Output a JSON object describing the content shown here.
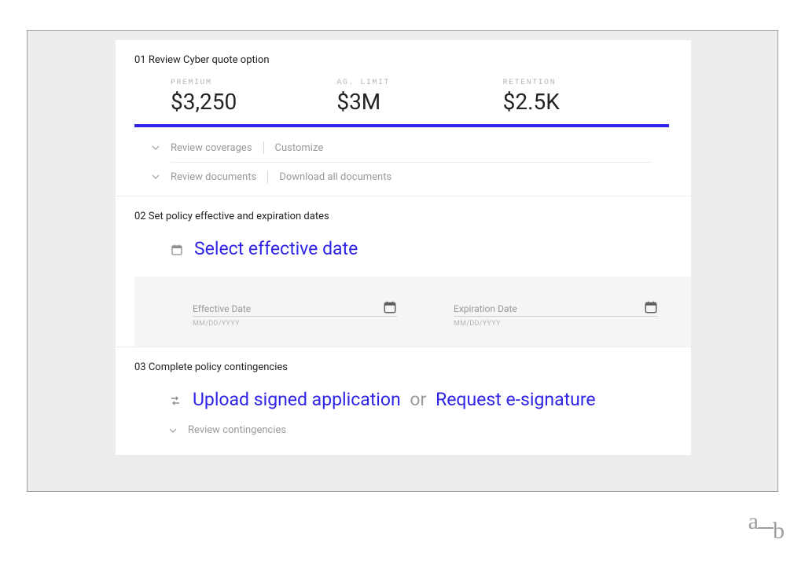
{
  "step1": {
    "title": "01 Review Cyber quote option",
    "metrics": {
      "premium_label": "PREMIUM",
      "premium_value": "$3,250",
      "limit_label": "AG. LIMIT",
      "limit_value": "$3M",
      "retention_label": "RETENTION",
      "retention_value": "$2.5K"
    },
    "review_coverages": "Review coverages",
    "customize": "Customize",
    "review_documents": "Review documents",
    "download_all": "Download all documents"
  },
  "step2": {
    "title": "02 Set policy effective and expiration dates",
    "headline": "Select effective date",
    "effective_label": "Effective Date",
    "expiration_label": "Expiration Date",
    "placeholder": "MM/DD/YYYY"
  },
  "step3": {
    "title": "03 Complete policy contingencies",
    "upload": "Upload signed application",
    "or": "or",
    "request": "Request e-signature",
    "review": "Review contingencies"
  },
  "logo": {
    "a": "a",
    "b": "b"
  }
}
